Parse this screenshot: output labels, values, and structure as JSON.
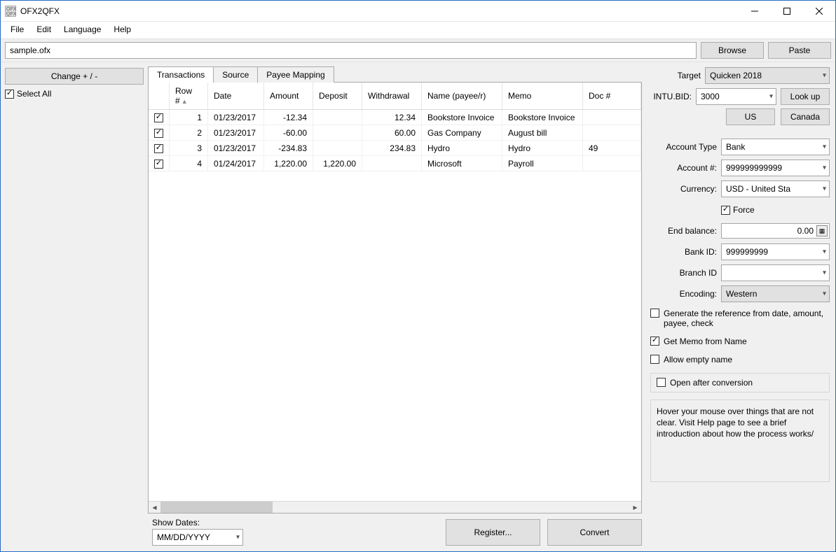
{
  "window": {
    "title": "OFX2QFX",
    "icon_label": "OFX QFX"
  },
  "menu": {
    "file": "File",
    "edit": "Edit",
    "language": "Language",
    "help": "Help"
  },
  "toolbar": {
    "file_value": "sample.ofx",
    "browse": "Browse",
    "paste": "Paste"
  },
  "left": {
    "change": "Change + / -",
    "select_all": "Select All"
  },
  "tabs": {
    "transactions": "Transactions",
    "source": "Source",
    "payee_mapping": "Payee Mapping"
  },
  "columns": {
    "row": "Row #",
    "date": "Date",
    "amount": "Amount",
    "deposit": "Deposit",
    "withdrawal": "Withdrawal",
    "name": "Name (payee/r)",
    "memo": "Memo",
    "doc": "Doc #"
  },
  "rows": [
    {
      "row": "1",
      "date": "01/23/2017",
      "amount": "-12.34",
      "deposit": "",
      "withdrawal": "12.34",
      "name": "Bookstore Invoice",
      "memo": "Bookstore Invoice",
      "doc": ""
    },
    {
      "row": "2",
      "date": "01/23/2017",
      "amount": "-60.00",
      "deposit": "",
      "withdrawal": "60.00",
      "name": "Gas Company",
      "memo": "August bill",
      "doc": ""
    },
    {
      "row": "3",
      "date": "01/23/2017",
      "amount": "-234.83",
      "deposit": "",
      "withdrawal": "234.83",
      "name": "Hydro",
      "memo": "Hydro",
      "doc": "49"
    },
    {
      "row": "4",
      "date": "01/24/2017",
      "amount": "1,220.00",
      "deposit": "1,220.00",
      "withdrawal": "",
      "name": "Microsoft",
      "memo": "Payroll",
      "doc": ""
    }
  ],
  "bottom": {
    "show_dates": "Show Dates:",
    "date_format": "MM/DD/YYYY",
    "register": "Register...",
    "convert": "Convert"
  },
  "right": {
    "target_label": "Target",
    "target_value": "Quicken 2018",
    "intu_label": "INTU.BID:",
    "intu_value": "3000",
    "lookup": "Look up",
    "us": "US",
    "canada": "Canada",
    "account_type_label": "Account Type",
    "account_type_value": "Bank",
    "account_num_label": "Account #:",
    "account_num_value": "999999999999",
    "currency_label": "Currency:",
    "currency_value": "USD - United Sta",
    "force": "Force",
    "end_balance_label": "End balance:",
    "end_balance_value": "0.00",
    "bank_id_label": "Bank ID:",
    "bank_id_value": "999999999",
    "branch_id_label": "Branch ID",
    "branch_id_value": "",
    "encoding_label": "Encoding:",
    "encoding_value": "Western",
    "gen_ref": "Generate the reference from date, amount, payee, check",
    "memo_from_name": "Get Memo from Name",
    "allow_empty": "Allow empty name",
    "open_after": "Open after conversion",
    "hint": "Hover your mouse over things that are not clear. Visit Help page to see a brief introduction about how the process works/"
  }
}
